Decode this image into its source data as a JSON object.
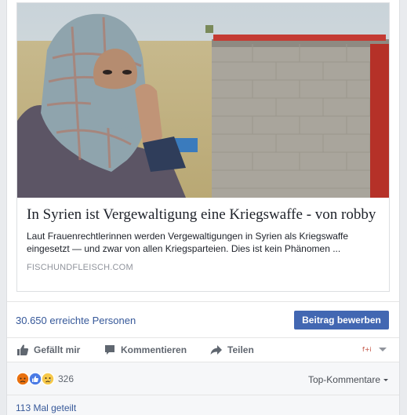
{
  "link_preview": {
    "image_alt": "Woman wearing a headscarf in front of a concrete block wall",
    "headline": "In Syrien ist Vergewaltigung eine Kriegswaffe - von robby",
    "description": "Laut Frauenrechtlerinnen werden Vergewaltigungen in Syrien als Kriegswaffe eingesetzt — und zwar von allen Kriegsparteien. Dies ist kein Phänomen ...",
    "domain": "FISCHUNDFLEISCH.COM"
  },
  "reach": {
    "text": "30.650 erreichte Personen",
    "promote_label": "Beitrag bewerben"
  },
  "actions": {
    "like": {
      "label": "Gefällt mir",
      "icon": "thumbs-up-icon"
    },
    "comment": {
      "label": "Kommentieren",
      "icon": "comment-icon"
    },
    "share": {
      "label": "Teilen",
      "icon": "share-arrow-icon"
    },
    "audience_icon": "page-avatar-icon"
  },
  "reactions": {
    "icons": [
      "angry-icon",
      "like-icon",
      "sad-icon"
    ],
    "count": "326",
    "sort_label": "Top-Kommentare"
  },
  "shares": {
    "text": "113 Mal geteilt"
  },
  "colors": {
    "link": "#365899",
    "button": "#4267b2",
    "muted": "#616770"
  }
}
